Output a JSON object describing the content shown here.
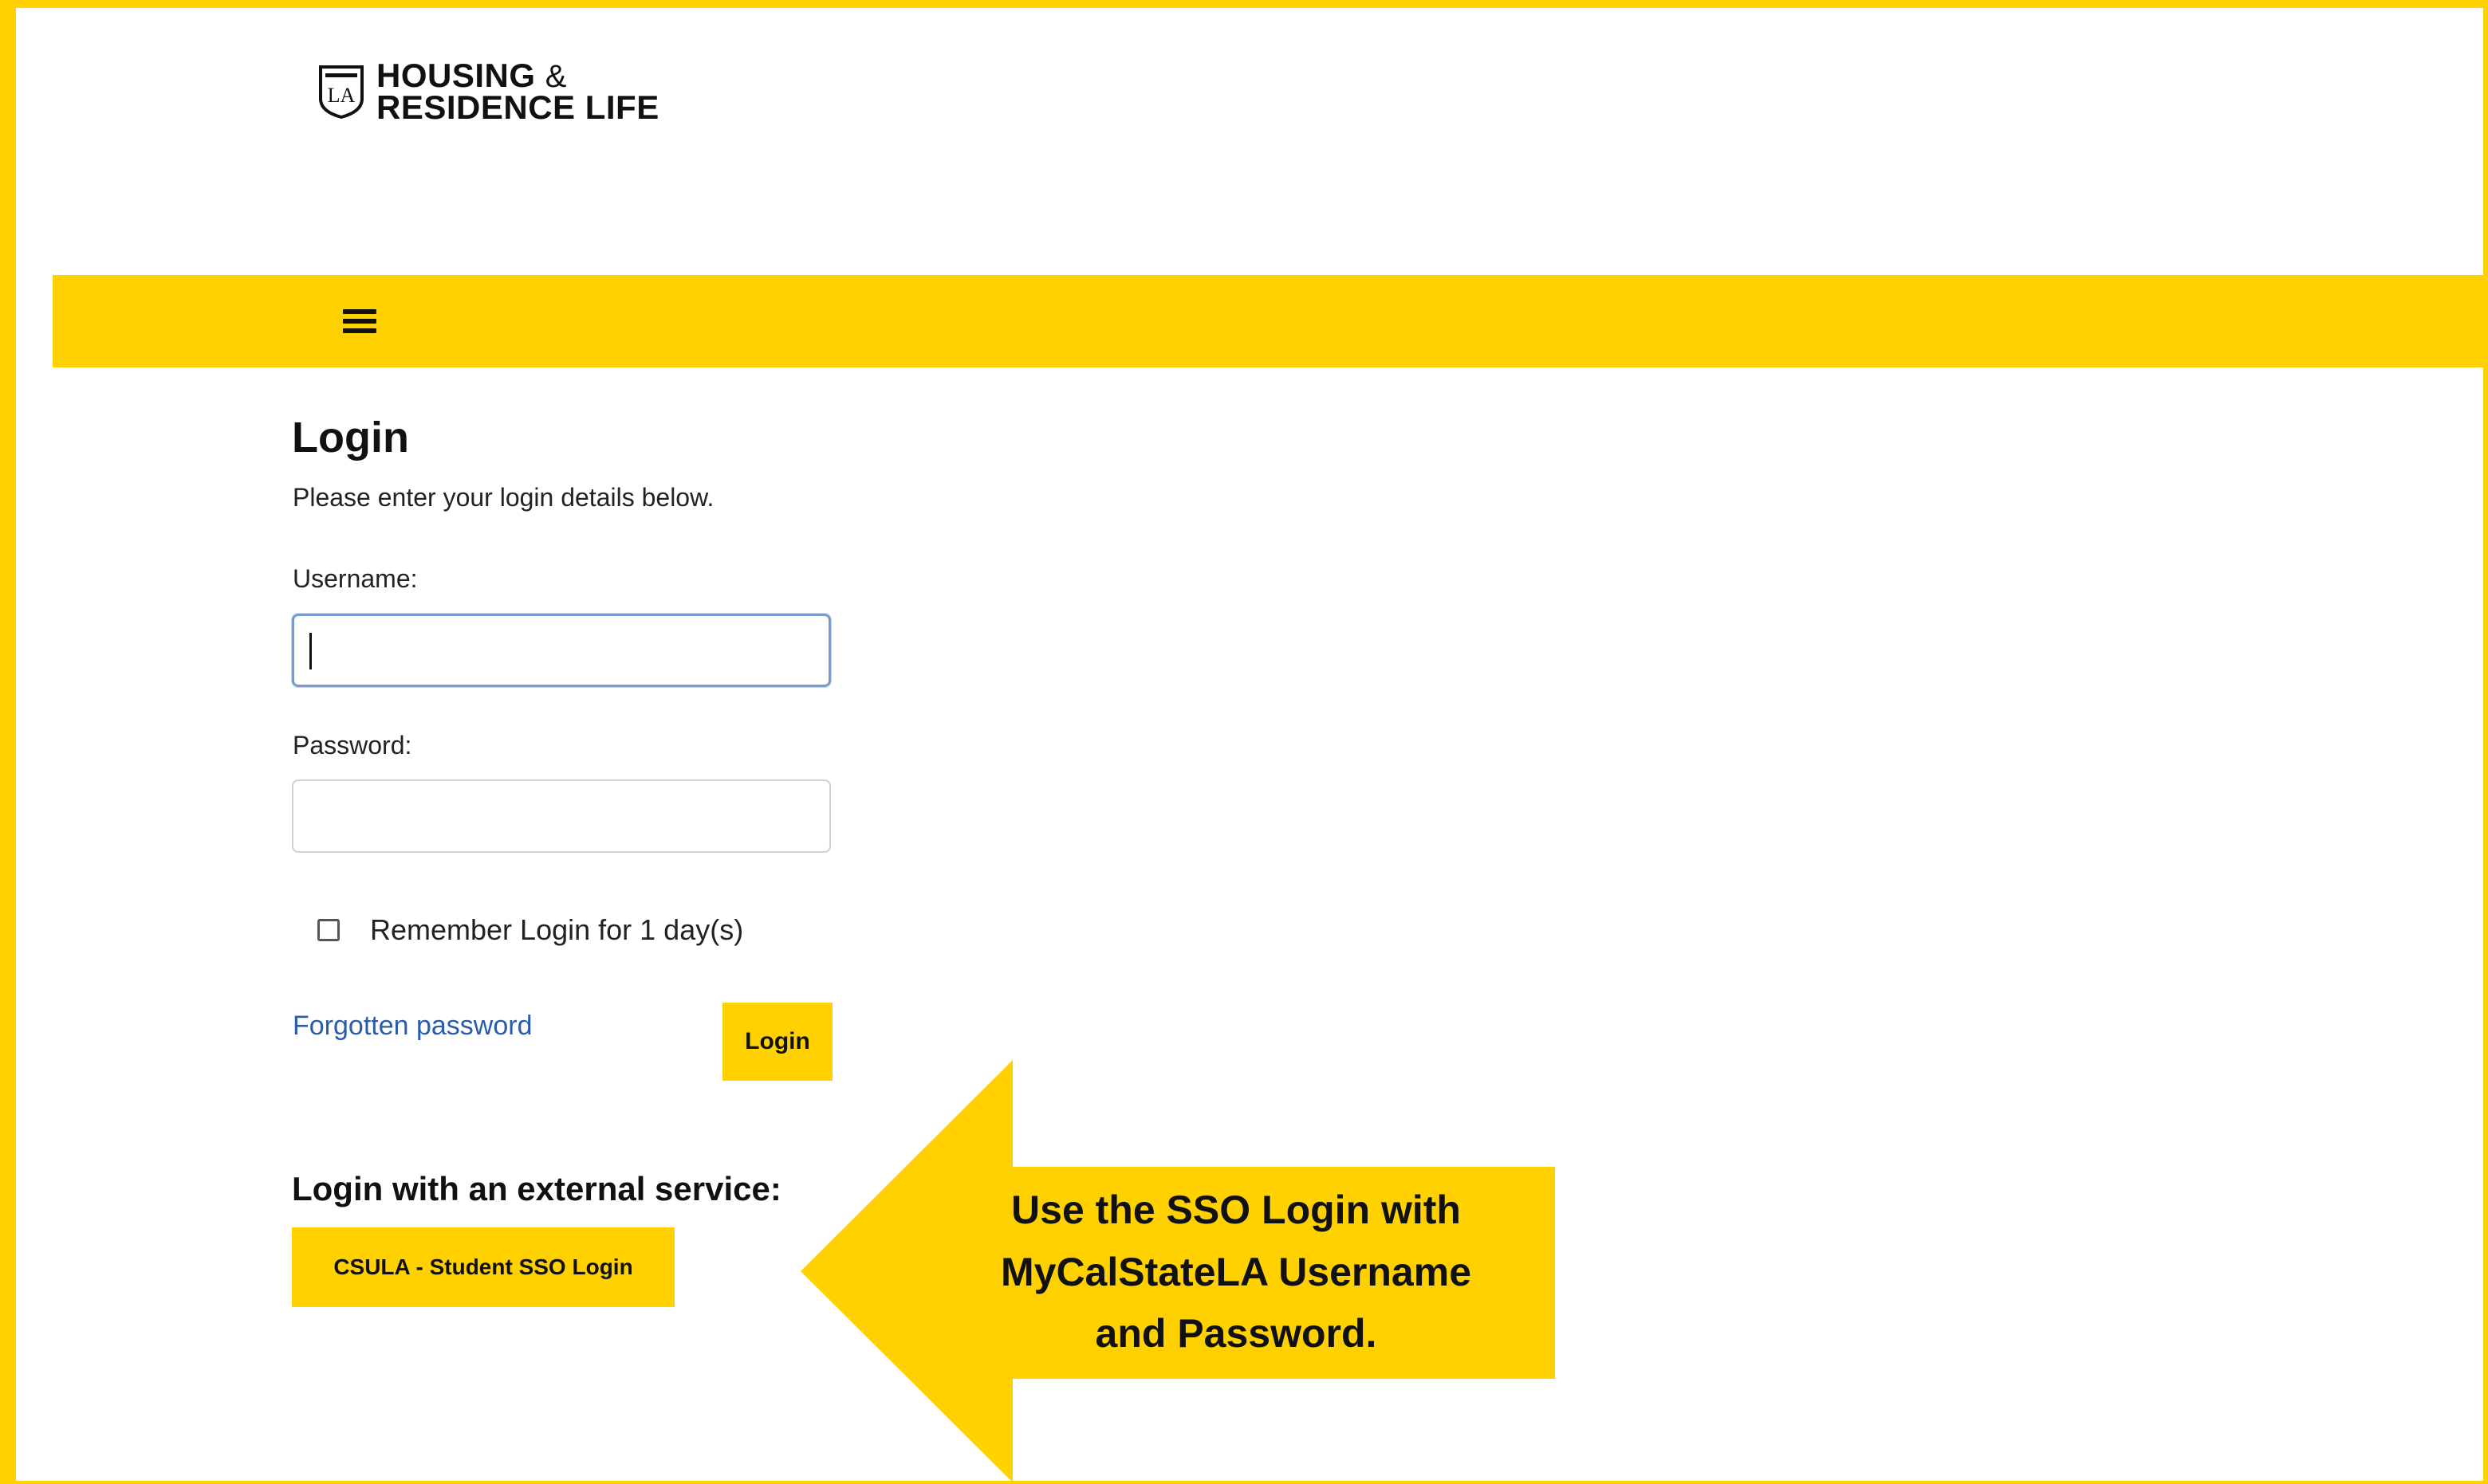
{
  "branding": {
    "logo_line1": "HOUSING",
    "logo_amp": "&",
    "logo_line2": "RESIDENCE LIFE",
    "accent_color": "#FFD100"
  },
  "navbar": {
    "menu_icon": "hamburger-menu-icon"
  },
  "login": {
    "title": "Login",
    "subtitle": "Please enter your login details below.",
    "username_label": "Username:",
    "username_value": "",
    "password_label": "Password:",
    "password_value": "",
    "remember_label": "Remember Login for 1 day(s)",
    "forgot_label": "Forgotten password",
    "login_button": "Login"
  },
  "external": {
    "heading": "Login with an external service:",
    "sso_button": "CSULA - Student SSO Login"
  },
  "callout": {
    "line1": "Use the SSO Login with",
    "line2": "MyCalStateLA Username",
    "line3": "and Password."
  }
}
